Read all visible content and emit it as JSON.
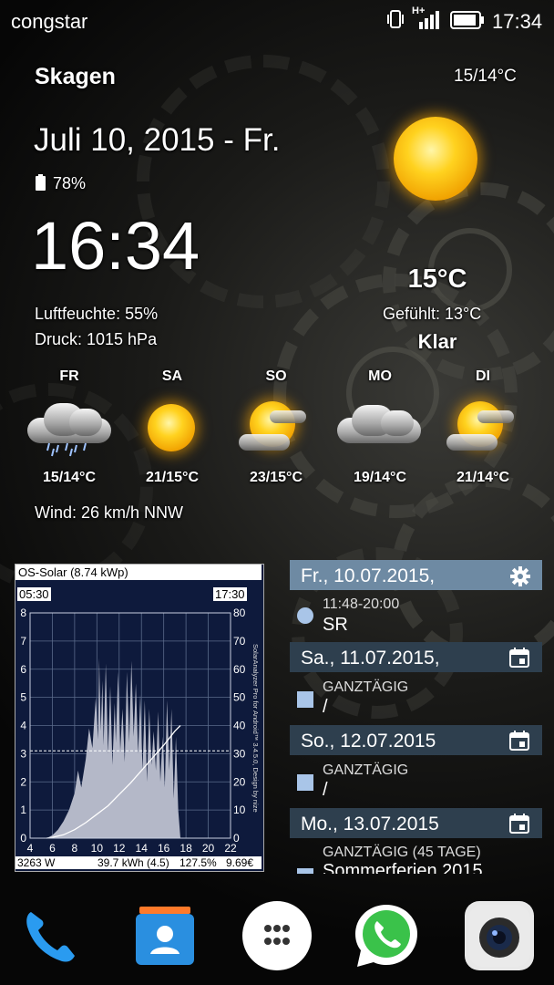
{
  "status_bar": {
    "carrier": "congstar",
    "network": "H+",
    "time": "17:34"
  },
  "widget": {
    "city": "Skagen",
    "hi_lo": "15/14°C",
    "date": "Juli 10, 2015 - Fr.",
    "battery": "78%",
    "clock": "16:34",
    "current_temp": "15°C",
    "humidity": "Luftfeuchte: 55%",
    "feels_like": "Gefühlt: 13°C",
    "pressure": "Druck: 1015 hPa",
    "condition": "Klar",
    "wind": "Wind: 26 km/h NNW",
    "forecast": [
      {
        "day": "FR",
        "temp": "15/14°C",
        "icon": "cloud-rain-icon"
      },
      {
        "day": "SA",
        "temp": "21/15°C",
        "icon": "sun-icon"
      },
      {
        "day": "SO",
        "temp": "23/15°C",
        "icon": "sun-cloud-icon"
      },
      {
        "day": "MO",
        "temp": "19/14°C",
        "icon": "cloudy-icon"
      },
      {
        "day": "DI",
        "temp": "21/14°C",
        "icon": "sun-cloud-icon"
      }
    ]
  },
  "solar": {
    "title": "OS-Solar (8.74 kWp)",
    "start": "05:30",
    "end": "17:30",
    "credit": "SolarAnalyzer Pro for Android™ 3.4.5.0, Design by nize",
    "footer_power": "3263 W",
    "footer_energy": "39.7 kWh (4.5)",
    "footer_pct": "127.5%",
    "footer_money": "9.69€",
    "colors": {
      "background": "#0e1a3c",
      "area": "#b4b8c8",
      "line": "#ffffff"
    }
  },
  "calendar": [
    {
      "header": "Fr., 10.07.2015,",
      "header_icon": "gear-icon",
      "time": "11:48-20:00",
      "title": "SR",
      "dot": "circle"
    },
    {
      "header": "Sa., 11.07.2015,",
      "header_icon": "calendar-icon",
      "time": "GANZTÄGIG",
      "title": "/",
      "dot": "square"
    },
    {
      "header": "So., 12.07.2015",
      "header_icon": "calendar-icon",
      "time": "GANZTÄGIG",
      "title": "/",
      "dot": "square"
    },
    {
      "header": "Mo., 13.07.2015",
      "header_icon": "calendar-icon",
      "time": "GANZTÄGIG (45 TAGE)",
      "title": "Sommerferien 2015",
      "dot": "square"
    }
  ],
  "chart_data": {
    "type": "area",
    "title": "OS-Solar (8.74 kWp)",
    "xlabel": "",
    "ylabel": "",
    "xlim": [
      4,
      22
    ],
    "ylim_left": [
      0,
      8
    ],
    "ylim_right": [
      0,
      80
    ],
    "x_ticks": [
      4,
      6,
      8,
      10,
      12,
      14,
      16,
      18,
      20,
      22
    ],
    "y_ticks_left": [
      0,
      1,
      2,
      3,
      4,
      5,
      6,
      7,
      8
    ],
    "y_ticks_right": [
      0,
      10,
      20,
      30,
      40,
      50,
      60,
      70,
      80
    ],
    "reference_line_left": 3.1,
    "series": [
      {
        "values_x": [
          5.5,
          6,
          6.5,
          7,
          7.5,
          8,
          8.3,
          8.6,
          9,
          9.3,
          9.6,
          9.9,
          10.1,
          10.2,
          10.35,
          10.5,
          10.6,
          10.8,
          11,
          11.2,
          11.4,
          11.6,
          11.7,
          11.9,
          12.1,
          12.3,
          12.5,
          12.7,
          12.9,
          13.1,
          13.3,
          13.5,
          13.7,
          13.9,
          14.1,
          14.3,
          14.5,
          14.7,
          14.9,
          15.1,
          15.3,
          15.5,
          15.7,
          15.9,
          16.1,
          16.3,
          16.5,
          16.7,
          16.9,
          17.1,
          17.3,
          17.5
        ],
        "values_y": [
          0,
          0.1,
          0.3,
          0.6,
          1.0,
          1.6,
          2.4,
          1.8,
          2.8,
          3.9,
          3.2,
          5.0,
          3.5,
          6.4,
          3.8,
          5.6,
          3.3,
          6.2,
          3.0,
          5.4,
          2.6,
          4.8,
          3.4,
          5.9,
          3.1,
          4.6,
          2.7,
          5.9,
          3.4,
          6.3,
          3.6,
          5.5,
          3.0,
          5.1,
          2.4,
          4.9,
          2.0,
          4.6,
          2.6,
          3.8,
          2.4,
          4.5,
          2.0,
          3.6,
          1.8,
          4.9,
          2.4,
          4.6,
          1.4,
          3.6,
          1.0,
          0
        ]
      },
      {
        "values_x": [
          5.5,
          6,
          7,
          8,
          9,
          10,
          11,
          12,
          13,
          14,
          15,
          16,
          17,
          17.5
        ],
        "values_y_right": [
          0,
          0.3,
          1.2,
          3,
          5.5,
          8.5,
          11.5,
          15.5,
          19.5,
          24,
          28.5,
          33,
          38,
          40
        ]
      }
    ]
  }
}
